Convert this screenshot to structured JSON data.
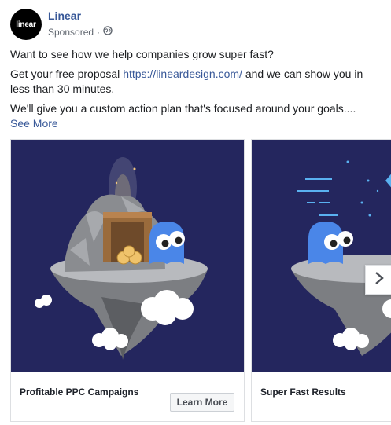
{
  "post": {
    "page_name": "Linear",
    "avatar_text": "linear",
    "sponsored": "Sponsored",
    "separator": "·",
    "globe_icon": "globe-icon",
    "line1": "Want to see how we help companies grow super fast?",
    "line2_pre": "Get your free proposal ",
    "line2_link": "https://lineardesign.com/",
    "line2_post": " and we can show you in less than 30 minutes.",
    "line3": "We'll give you a custom action plan that's focused around your goals....",
    "see_more": "See More"
  },
  "carousel": {
    "cards": [
      {
        "title": "Profitable PPC Campaigns",
        "cta": "Learn More"
      },
      {
        "title": "Super Fast Results"
      }
    ],
    "next_icon": "chevron-right-icon"
  },
  "colors": {
    "link": "#385898",
    "card_bg": "#24265e",
    "blob": "#4a86e8",
    "rock": "#8a8c90"
  }
}
